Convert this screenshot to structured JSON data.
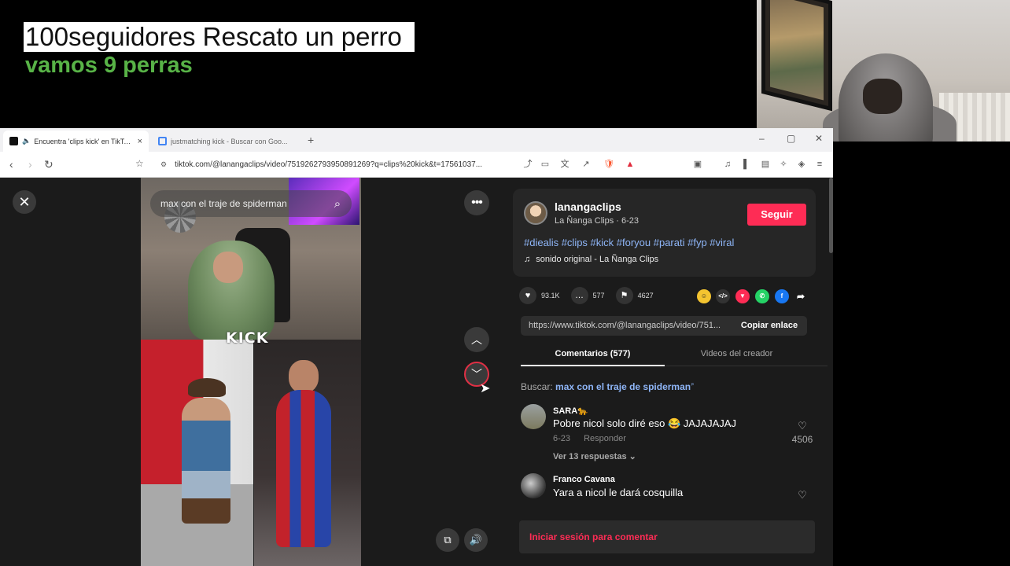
{
  "overlay": {
    "title": "100seguidores Rescato un perro",
    "subtitle": "vamos 9 perras"
  },
  "browser": {
    "tabs": [
      {
        "label": "Encuentra 'clips kick' en TikTo...",
        "close": "×"
      },
      {
        "label": "justmatching kick - Buscar con Goo..."
      }
    ],
    "new_tab": "+",
    "url": "tiktok.com/@lanangaclips/video/7519262793950891269?q=clips%20kick&t=17561037..."
  },
  "video": {
    "search_query": "max con el traje de spiderman",
    "overlay_text": "KICK"
  },
  "creator": {
    "username": "lanangaclips",
    "subline": "La Ñanga Clips · 6-23",
    "follow_label": "Seguir",
    "hashtags": "#diealis #clips #kick #foryou #parati #fyp #viral",
    "sound": "sonido original - La Ñanga Clips"
  },
  "stats": {
    "likes": "93.1K",
    "comments": "577",
    "saves": "4627"
  },
  "link": {
    "url": "https://www.tiktok.com/@lanangaclips/video/751...",
    "copy_label": "Copiar enlace"
  },
  "panel_tabs": {
    "comments": "Comentarios (577)",
    "creator_videos": "Videos del creador"
  },
  "search_hint": {
    "prefix": "Buscar:",
    "term": "max con el traje de spiderman"
  },
  "comments": [
    {
      "user": "SARA🐆",
      "text": "Pobre nicol solo diré eso 😂 JAJAJAJAJ",
      "date": "6-23",
      "reply": "Responder",
      "replies": "Ver 13 respuestas ⌄",
      "likes": "4506"
    },
    {
      "user": "Franco Cavana",
      "text": "Yara a nicol le dará cosquilla",
      "date": "",
      "reply": "",
      "replies": "",
      "likes": ""
    }
  ],
  "login_prompt": "Iniciar sesión para comentar",
  "colors": {
    "accent": "#fe2c55",
    "hashtag": "#8fb6f8",
    "overlay_green": "#58b347"
  }
}
